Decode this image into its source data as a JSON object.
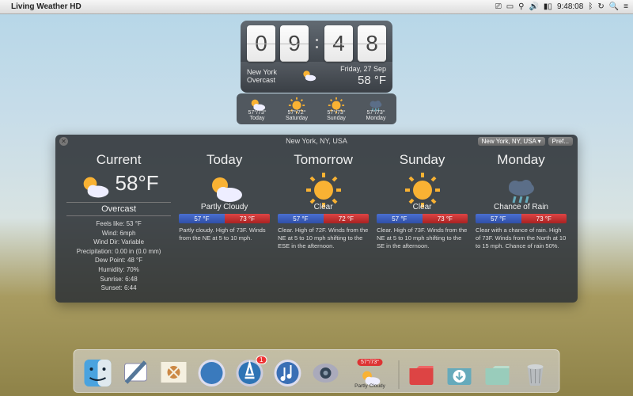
{
  "menubar": {
    "app_title": "Living Weather HD",
    "clock": "9:48:08"
  },
  "flip": {
    "h1": "0",
    "h2": "9",
    "m1": "4",
    "m2": "8",
    "city": "New York",
    "condition": "Overcast",
    "date": "Friday, 27 Sep",
    "temp": "58 °F"
  },
  "mini": [
    {
      "icon": "partly",
      "temps": "57°/73°",
      "label": "Today"
    },
    {
      "icon": "sunny",
      "temps": "57°/72°",
      "label": "Saturday"
    },
    {
      "icon": "sunny",
      "temps": "57°/73°",
      "label": "Sunday"
    },
    {
      "icon": "rain",
      "temps": "57°/73°",
      "label": "Monday"
    }
  ],
  "panel": {
    "title": "New York, NY, USA",
    "location_btn": "New York, NY, USA ▾",
    "pref_btn": "Pref...",
    "current": {
      "heading": "Current",
      "temp": "58°F",
      "condition": "Overcast",
      "stats": [
        "Feels like: 53 °F",
        "Wind: 6mph",
        "Wind Dir: Variable",
        "Precipitation: 0.00 in (0.0 mm)",
        "Dew Point: 48 °F",
        "Humidity: 70%",
        "Sunrise: 6:48",
        "Sunset: 6:44"
      ]
    },
    "forecast": [
      {
        "heading": "Today",
        "icon": "partly",
        "cond": "Partly Cloudy",
        "lo": "57 °F",
        "hi": "73 °F",
        "text": "Partly cloudy. High of 73F. Winds from the NE at 5 to 10 mph."
      },
      {
        "heading": "Tomorrow",
        "icon": "sunny",
        "cond": "Clear",
        "lo": "57 °F",
        "hi": "72 °F",
        "text": "Clear. High of 72F. Winds from the NE at 5 to 10 mph shifting to the ESE in the afternoon."
      },
      {
        "heading": "Sunday",
        "icon": "sunny",
        "cond": "Clear",
        "lo": "57 °F",
        "hi": "73 °F",
        "text": "Clear. High of 73F. Winds from the NE at 5 to 10 mph shifting to the SE in the afternoon."
      },
      {
        "heading": "Monday",
        "icon": "rain",
        "cond": "Chance of Rain",
        "lo": "57 °F",
        "hi": "73 °F",
        "text": "Clear with a chance of rain. High of 73F. Winds from the North at 10 to 15 mph. Chance of rain 50%."
      }
    ]
  },
  "dock": {
    "appstore_badge": "1",
    "weather_temps": "57°/73°",
    "weather_label": "Partly Cloudy"
  }
}
